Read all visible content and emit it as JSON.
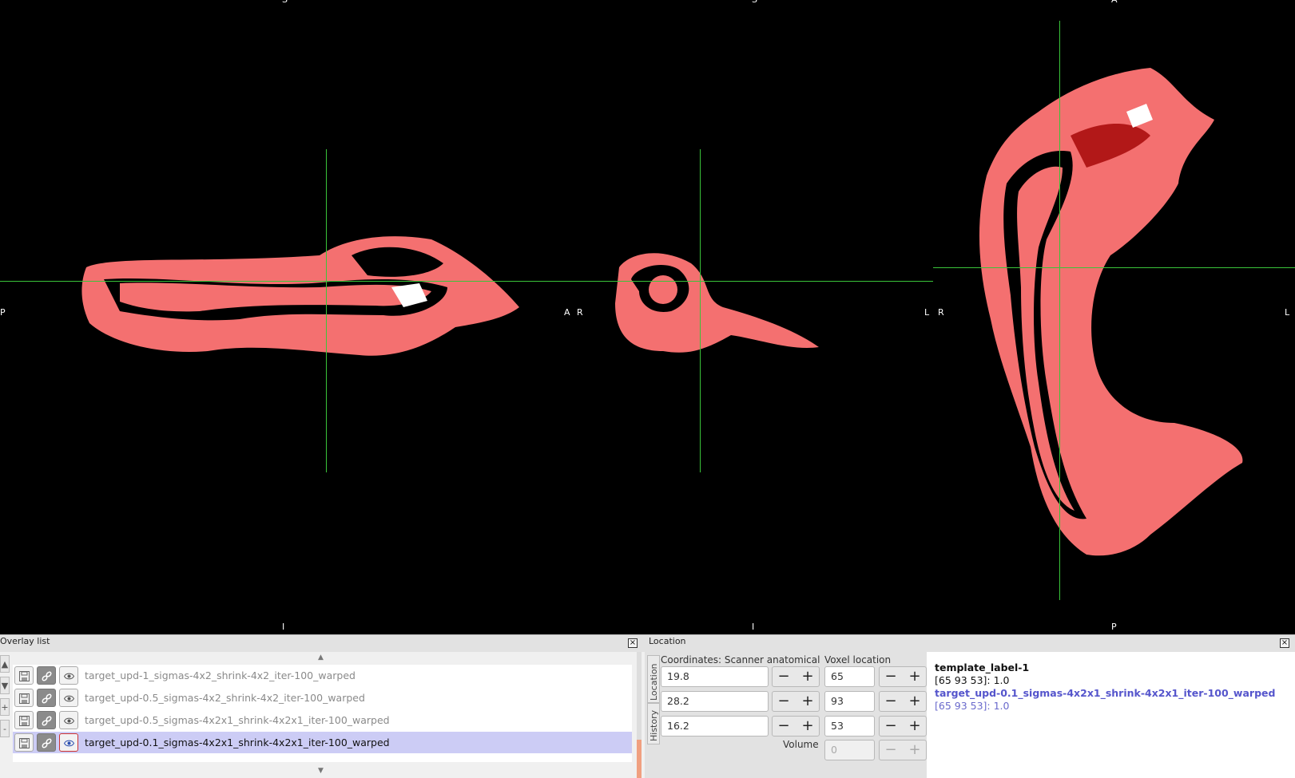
{
  "viewer": {
    "top_labels": [
      "S",
      "S",
      "A"
    ],
    "bottom_labels": [
      "I",
      "I",
      "P"
    ],
    "side_labels": [
      "P",
      "A",
      "R",
      "L",
      "R",
      "L"
    ],
    "crosshair_color": "#3ac43a",
    "label_color": "#f47070"
  },
  "overlay_panel": {
    "title": "Overlay list",
    "side_buttons": [
      "▲",
      "▼",
      "+",
      "-"
    ],
    "rows": [
      {
        "name": "target_upd-1_sigmas-4x2_shrink-4x2_iter-100_warped",
        "selected": false
      },
      {
        "name": "target_upd-0.5_sigmas-4x2_shrink-4x2_iter-100_warped",
        "selected": false
      },
      {
        "name": "target_upd-0.5_sigmas-4x2x1_shrink-4x2x1_iter-100_warped",
        "selected": false
      },
      {
        "name": "target_upd-0.1_sigmas-4x2x1_shrink-4x2x1_iter-100_warped",
        "selected": true
      }
    ]
  },
  "location_panel": {
    "title": "Location",
    "tabs": [
      "Location",
      "History"
    ],
    "coords_header": "Coordinates: Scanner anatomical",
    "voxel_header": "Voxel location",
    "coords": [
      "19.8",
      "28.2",
      "16.2"
    ],
    "voxels": [
      "65",
      "93",
      "53"
    ],
    "volume_label": "Volume",
    "volume_value": "0",
    "info": {
      "line1": "template_label-1",
      "line2": "[65 93 53]: 1.0",
      "line3": "target_upd-0.1_sigmas-4x2x1_shrink-4x2x1_iter-100_warped",
      "line4": "[65 93 53]: 1.0"
    }
  }
}
